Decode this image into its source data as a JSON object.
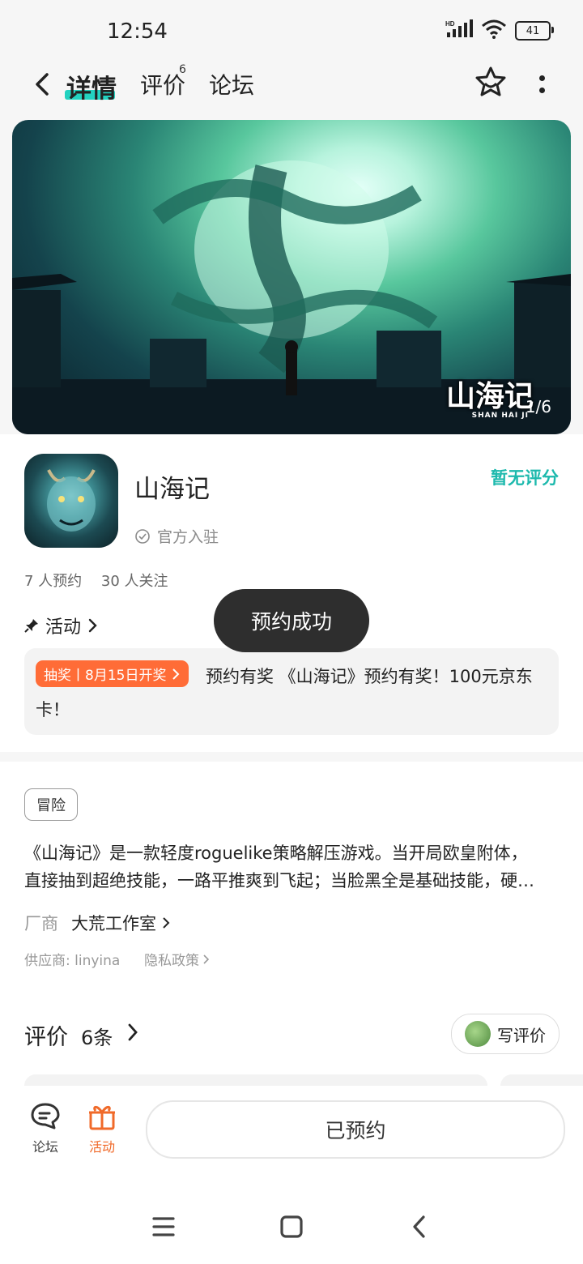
{
  "status_bar": {
    "time": "12:54",
    "network": "HD",
    "battery": "41"
  },
  "nav": {
    "tab_detail": "详情",
    "tab_review": "评价",
    "tab_review_badge": "6",
    "tab_forum": "论坛"
  },
  "banner": {
    "counter": "1/6",
    "logo_text": "山海记",
    "logo_sub": "SHAN HAI JI"
  },
  "app": {
    "name": "山海记",
    "official": "官方入驻",
    "rating": "暂无评分",
    "reservations": "7 人预约",
    "follows": "30 人关注"
  },
  "activity": {
    "header": "活动",
    "tag": "抽奖丨8月15日开奖",
    "text": "预约有奖 《山海记》预约有奖！100元京东卡！"
  },
  "toast": "预约成功",
  "info": {
    "genre": "冒险",
    "desc_line1": "《山海记》是一款轻度roguelike策略解压游戏。当开局欧皇附体，",
    "desc_line2": "直接抽到超绝技能，一路平推爽到飞起；当脸黑全是基础技能，硬…",
    "maker_label": "厂商",
    "maker": "大荒工作室",
    "supplier": "供应商: linyina",
    "privacy": "隐私政策"
  },
  "reviews": {
    "title": "评价",
    "count": "6条",
    "write": "写评价"
  },
  "bottom": {
    "forum": "论坛",
    "activity": "活动",
    "reserved": "已预约"
  },
  "colors": {
    "accent": "#23d2c0",
    "rating": "#1db9ad",
    "orange": "#ff6c37",
    "toast": "#2e2e2e"
  }
}
